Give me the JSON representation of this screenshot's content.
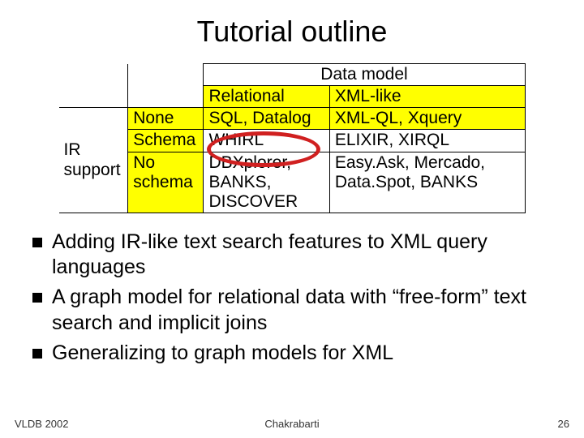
{
  "title": "Tutorial outline",
  "table": {
    "top_header": "Data model",
    "col_rel": "Relational",
    "col_xml": "XML-like",
    "row_side_label": "IR support",
    "r1_label": "None",
    "r1_rel": "SQL, Datalog",
    "r1_xml": "XML-QL, Xquery",
    "r2_label": "Schema",
    "r2_rel": "WHIRL",
    "r2_xml": "ELIXIR, XIRQL",
    "r3_label": "No schema",
    "r3_rel": "DBXplorer, BANKS, DISCOVER",
    "r3_xml": "Easy.Ask, Mercado, Data.Spot, BANKS"
  },
  "bullets": [
    "Adding IR-like text search features to XML query languages",
    "A graph model for relational data with “free-form” text search and implicit joins",
    "Generalizing to graph models for XML"
  ],
  "footer": {
    "left": "VLDB 2002",
    "center": "Chakrabarti",
    "right": "26"
  },
  "annotation": {
    "name": "whirl-circle"
  }
}
